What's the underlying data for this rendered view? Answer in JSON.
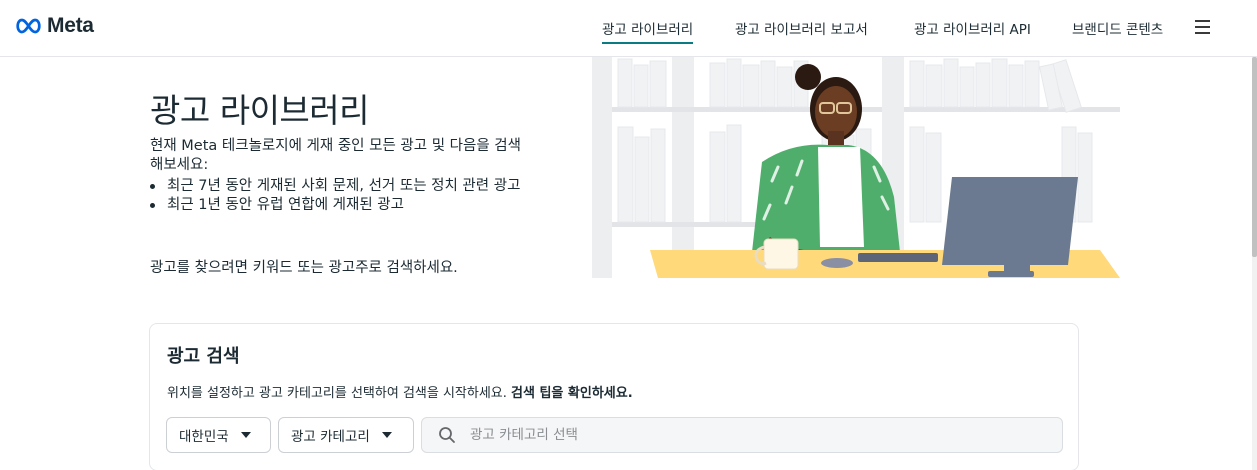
{
  "header": {
    "brand": "Meta",
    "nav": [
      {
        "label": "광고 라이브러리",
        "active": true
      },
      {
        "label": "광고 라이브러리 보고서",
        "active": false
      },
      {
        "label": "광고 라이브러리 API",
        "active": false
      },
      {
        "label": "브랜디드 콘텐츠",
        "active": false
      }
    ],
    "menu_icon": "hamburger-menu-icon"
  },
  "hero": {
    "title": "광고 라이브러리",
    "intro": "현재 Meta 테크놀로지에 게재 중인 모든 광고 및 다음을 검색해보세요:",
    "bullets": [
      "최근 7년 동안 게재된 사회 문제, 선거 또는 정치 관련 광고",
      "최근 1년 동안 유럽 연합에 게재된 광고"
    ],
    "cta": "광고를 찾으려면 키워드 또는 광고주로 검색하세요."
  },
  "search_card": {
    "title": "광고 검색",
    "description": "위치를 설정하고 광고 카테고리를 선택하여 검색을 시작하세요.",
    "tip_link": "검색 팁을 확인하세요.",
    "country_select": "대한민국",
    "category_select": "광고 카테고리",
    "search_placeholder": "광고 카테고리 선택",
    "search_value": ""
  },
  "colors": {
    "active_underline": "#0a7b83",
    "brand_blue": "#0064e0",
    "text": "#1c2b33"
  }
}
